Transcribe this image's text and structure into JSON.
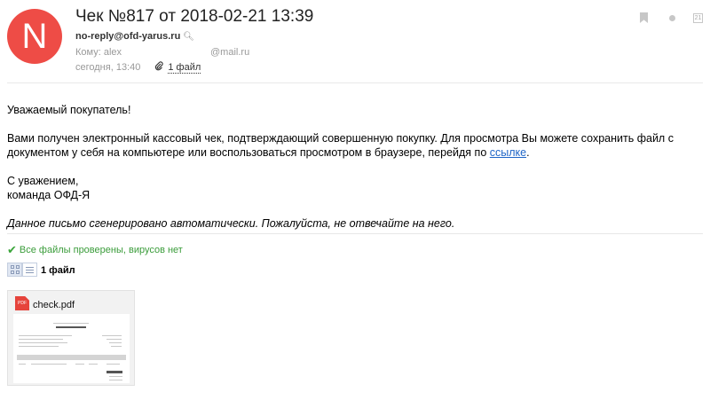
{
  "header": {
    "avatar_letter": "N",
    "subject": "Чек №817 от 2018-02-21 13:39",
    "from": "no-reply@ofd-yarus.ru",
    "to_prefix": "Кому: alex",
    "to_domain": "@mail.ru",
    "date": "сегодня, 13:40",
    "attachments_link": "1 файл"
  },
  "body": {
    "greeting": "Уважаемый покупатель!",
    "paragraph_main": "Вами получен электронный кассовый чек, подтверждающий совершенную покупку. Для просмотра Вы можете сохранить файл с документом у себя на компьютере или воспользоваться просмотром в браузере, перейдя по ",
    "link_text": "ссылке",
    "paragraph_end": ".",
    "signoff_1": "С уважением,",
    "signoff_2": "команда ОФД-Я",
    "auto_note": "Данное письмо сгенерировано автоматически. Пожалуйста, не отвечайте на него."
  },
  "attachments": {
    "virus_check": "Все файлы проверены, вирусов нет",
    "count_label": "1 файл",
    "files": [
      {
        "name": "check.pdf",
        "type_badge": "PDF"
      }
    ]
  },
  "icons": {
    "avatar_color": "#ee4c46",
    "link_color": "#1f65c7",
    "virus_ok_color": "#3a9c3a",
    "pdf_color": "#e6443c",
    "calendar_day": "21"
  }
}
